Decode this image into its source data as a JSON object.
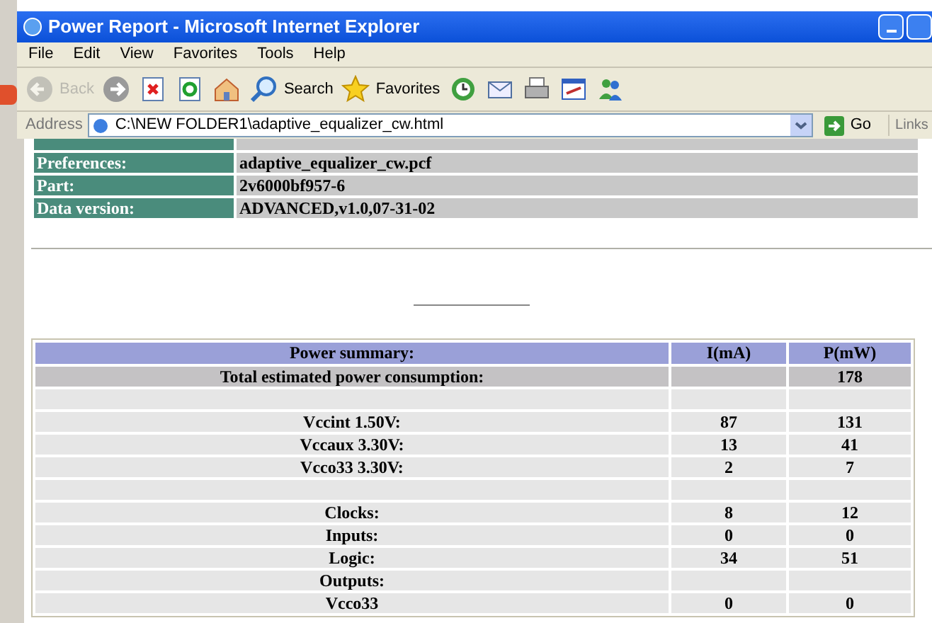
{
  "window": {
    "title": "Power Report - Microsoft Internet Explorer"
  },
  "menu": [
    "File",
    "Edit",
    "View",
    "Favorites",
    "Tools",
    "Help"
  ],
  "toolbar": [
    {
      "kind": "back",
      "label": "Back",
      "disabled": true
    },
    {
      "kind": "forward",
      "disabled": false
    },
    {
      "kind": "stop"
    },
    {
      "kind": "refresh"
    },
    {
      "kind": "home"
    },
    {
      "kind": "search",
      "label": "Search"
    },
    {
      "kind": "favorites",
      "label": "Favorites"
    },
    {
      "kind": "history"
    },
    {
      "kind": "mail"
    },
    {
      "kind": "print"
    },
    {
      "kind": "edit"
    },
    {
      "kind": "messenger"
    }
  ],
  "address_bar": {
    "label": "Address",
    "value": "C:\\NEW FOLDER1\\adaptive_equalizer_cw.html",
    "go": "Go",
    "links": "Links"
  },
  "info_table": [
    {
      "label": "Preferences:",
      "value": "adaptive_equalizer_cw.pcf"
    },
    {
      "label": "Part:",
      "value": "2v6000bf957-6"
    },
    {
      "label": "Data version:",
      "value": "ADVANCED,v1.0,07-31-02"
    }
  ],
  "power_table": {
    "columns": [
      "Power summary:",
      "I(mA)",
      "P(mW)"
    ],
    "rows": [
      {
        "kind": "total",
        "cells": [
          "Total estimated power consumption:",
          "",
          "178"
        ]
      },
      {
        "kind": "normal",
        "cells": [
          "",
          "",
          ""
        ]
      },
      {
        "kind": "normal",
        "cells": [
          "Vccint 1.50V:",
          "87",
          "131"
        ]
      },
      {
        "kind": "normal",
        "cells": [
          "Vccaux 3.30V:",
          "13",
          "41"
        ]
      },
      {
        "kind": "normal",
        "cells": [
          "Vcco33 3.30V:",
          "2",
          "7"
        ]
      },
      {
        "kind": "normal",
        "cells": [
          "",
          "",
          ""
        ]
      },
      {
        "kind": "normal",
        "cells": [
          "Clocks:",
          "8",
          "12"
        ]
      },
      {
        "kind": "normal",
        "cells": [
          "Inputs:",
          "0",
          "0"
        ]
      },
      {
        "kind": "normal",
        "cells": [
          "Logic:",
          "34",
          "51"
        ]
      },
      {
        "kind": "normal",
        "cells": [
          "Outputs:",
          "",
          ""
        ]
      },
      {
        "kind": "normal",
        "cells": [
          "Vcco33",
          "0",
          "0"
        ]
      }
    ]
  }
}
